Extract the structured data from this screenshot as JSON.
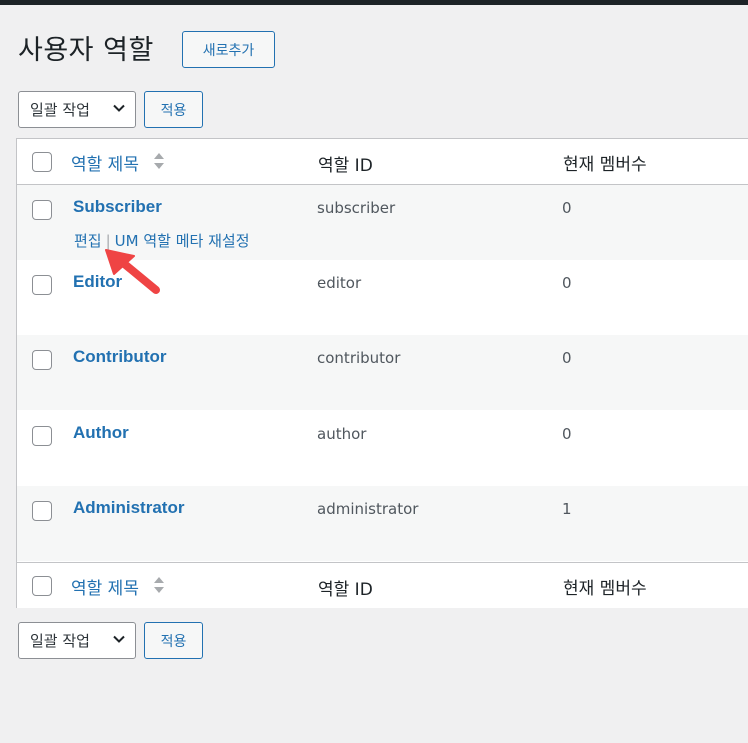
{
  "page": {
    "title": "사용자 역할",
    "add_new_label": "새로추가"
  },
  "bulk": {
    "select_label": "일괄 작업",
    "apply_label": "적용"
  },
  "columns": {
    "title": "역할 제목",
    "id": "역할 ID",
    "count": "현재 멤버수"
  },
  "rows": [
    {
      "title": "Subscriber",
      "id": "subscriber",
      "count": "0"
    },
    {
      "title": "Editor",
      "id": "editor",
      "count": "0"
    },
    {
      "title": "Contributor",
      "id": "contributor",
      "count": "0"
    },
    {
      "title": "Author",
      "id": "author",
      "count": "0"
    },
    {
      "title": "Administrator",
      "id": "administrator",
      "count": "1"
    }
  ],
  "row_actions": {
    "edit": "편집",
    "separator": "|",
    "reset": "UM 역할 메타 재설정"
  },
  "colors": {
    "link": "#2271b1",
    "arrow": "#ef4444",
    "topbar": "#1d2327"
  },
  "icons": {
    "sort": "sort-arrows-icon",
    "dropdown": "chevron-down-icon",
    "pointer": "red-arrow-icon"
  }
}
